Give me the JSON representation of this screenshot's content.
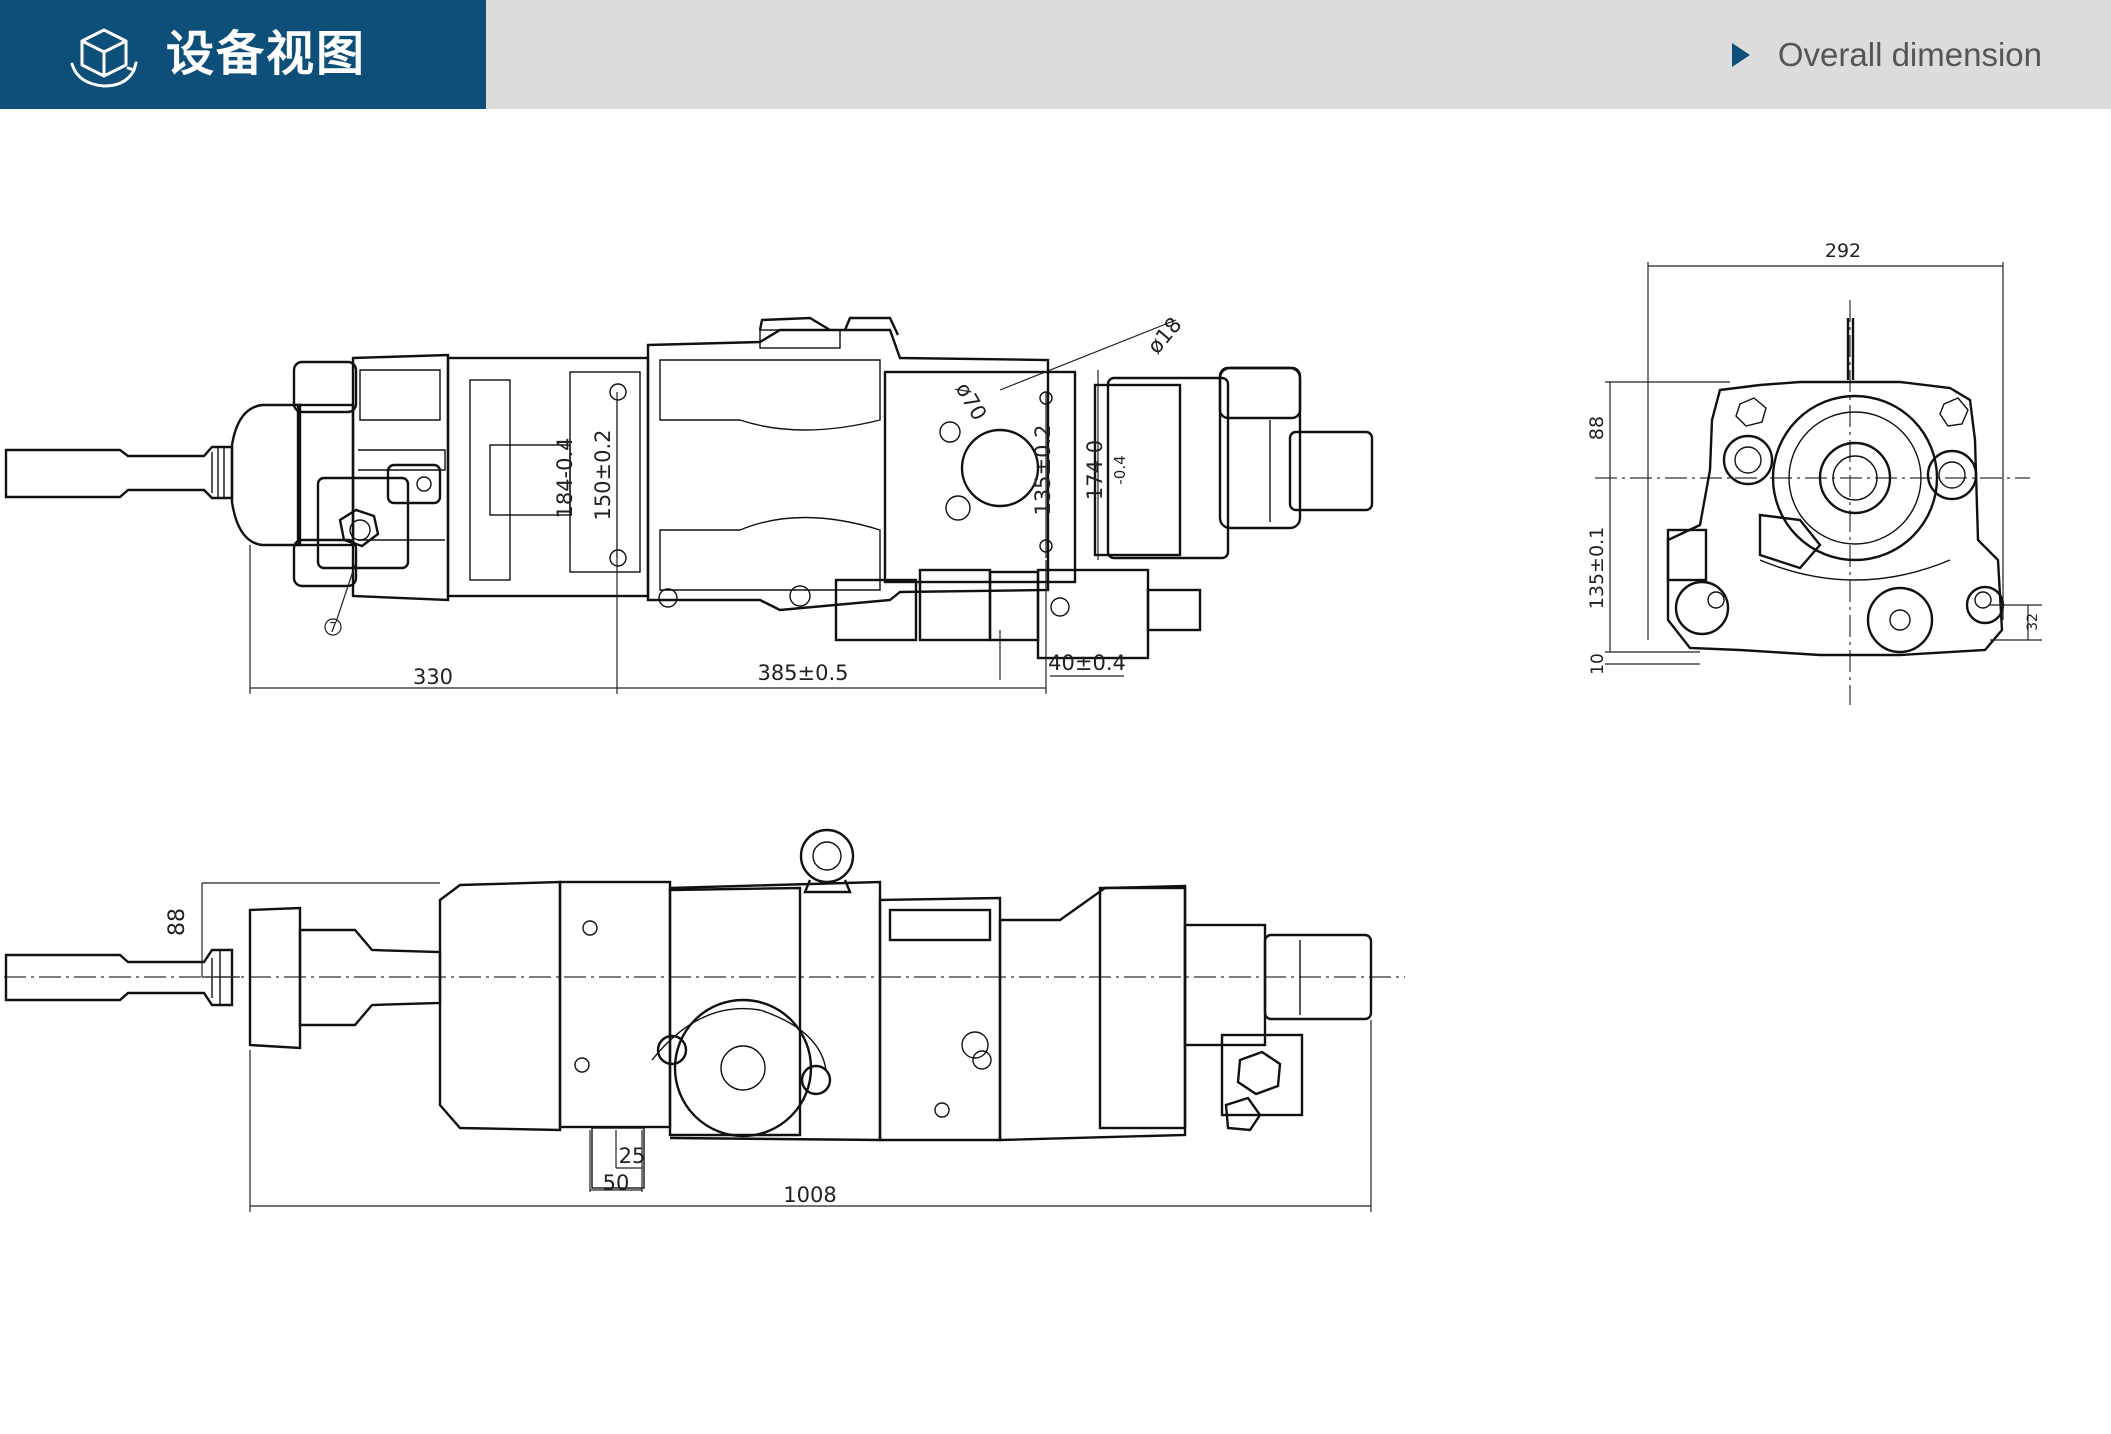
{
  "header": {
    "title": "设备视图",
    "section_label": "Overall dimension",
    "icons": {
      "logo": "3d-cube-rotate-icon",
      "marker": "triangle-right-icon"
    },
    "colors": {
      "brand": "#0e4f79",
      "header_bg": "#dcdcdc"
    }
  },
  "drawing": {
    "top_view": {
      "dims": {
        "d330": "330",
        "d385": "385±0.5",
        "d40": "40±0.4",
        "d184": "184-0.4",
        "d150": "150±0.2",
        "d135": "135±0.2",
        "d174": "174 0",
        "d174sub": "-0.4",
        "phi70": "ø70",
        "phi18": "ø18",
        "callout7": "7"
      }
    },
    "side_view": {
      "dims": {
        "d88": "88",
        "d25": "25",
        "d50": "50",
        "d1008": "1008"
      }
    },
    "end_view": {
      "dims": {
        "d292": "292",
        "d88": "88",
        "d135": "135±0.1",
        "d10": "10",
        "d32": "32"
      }
    }
  }
}
